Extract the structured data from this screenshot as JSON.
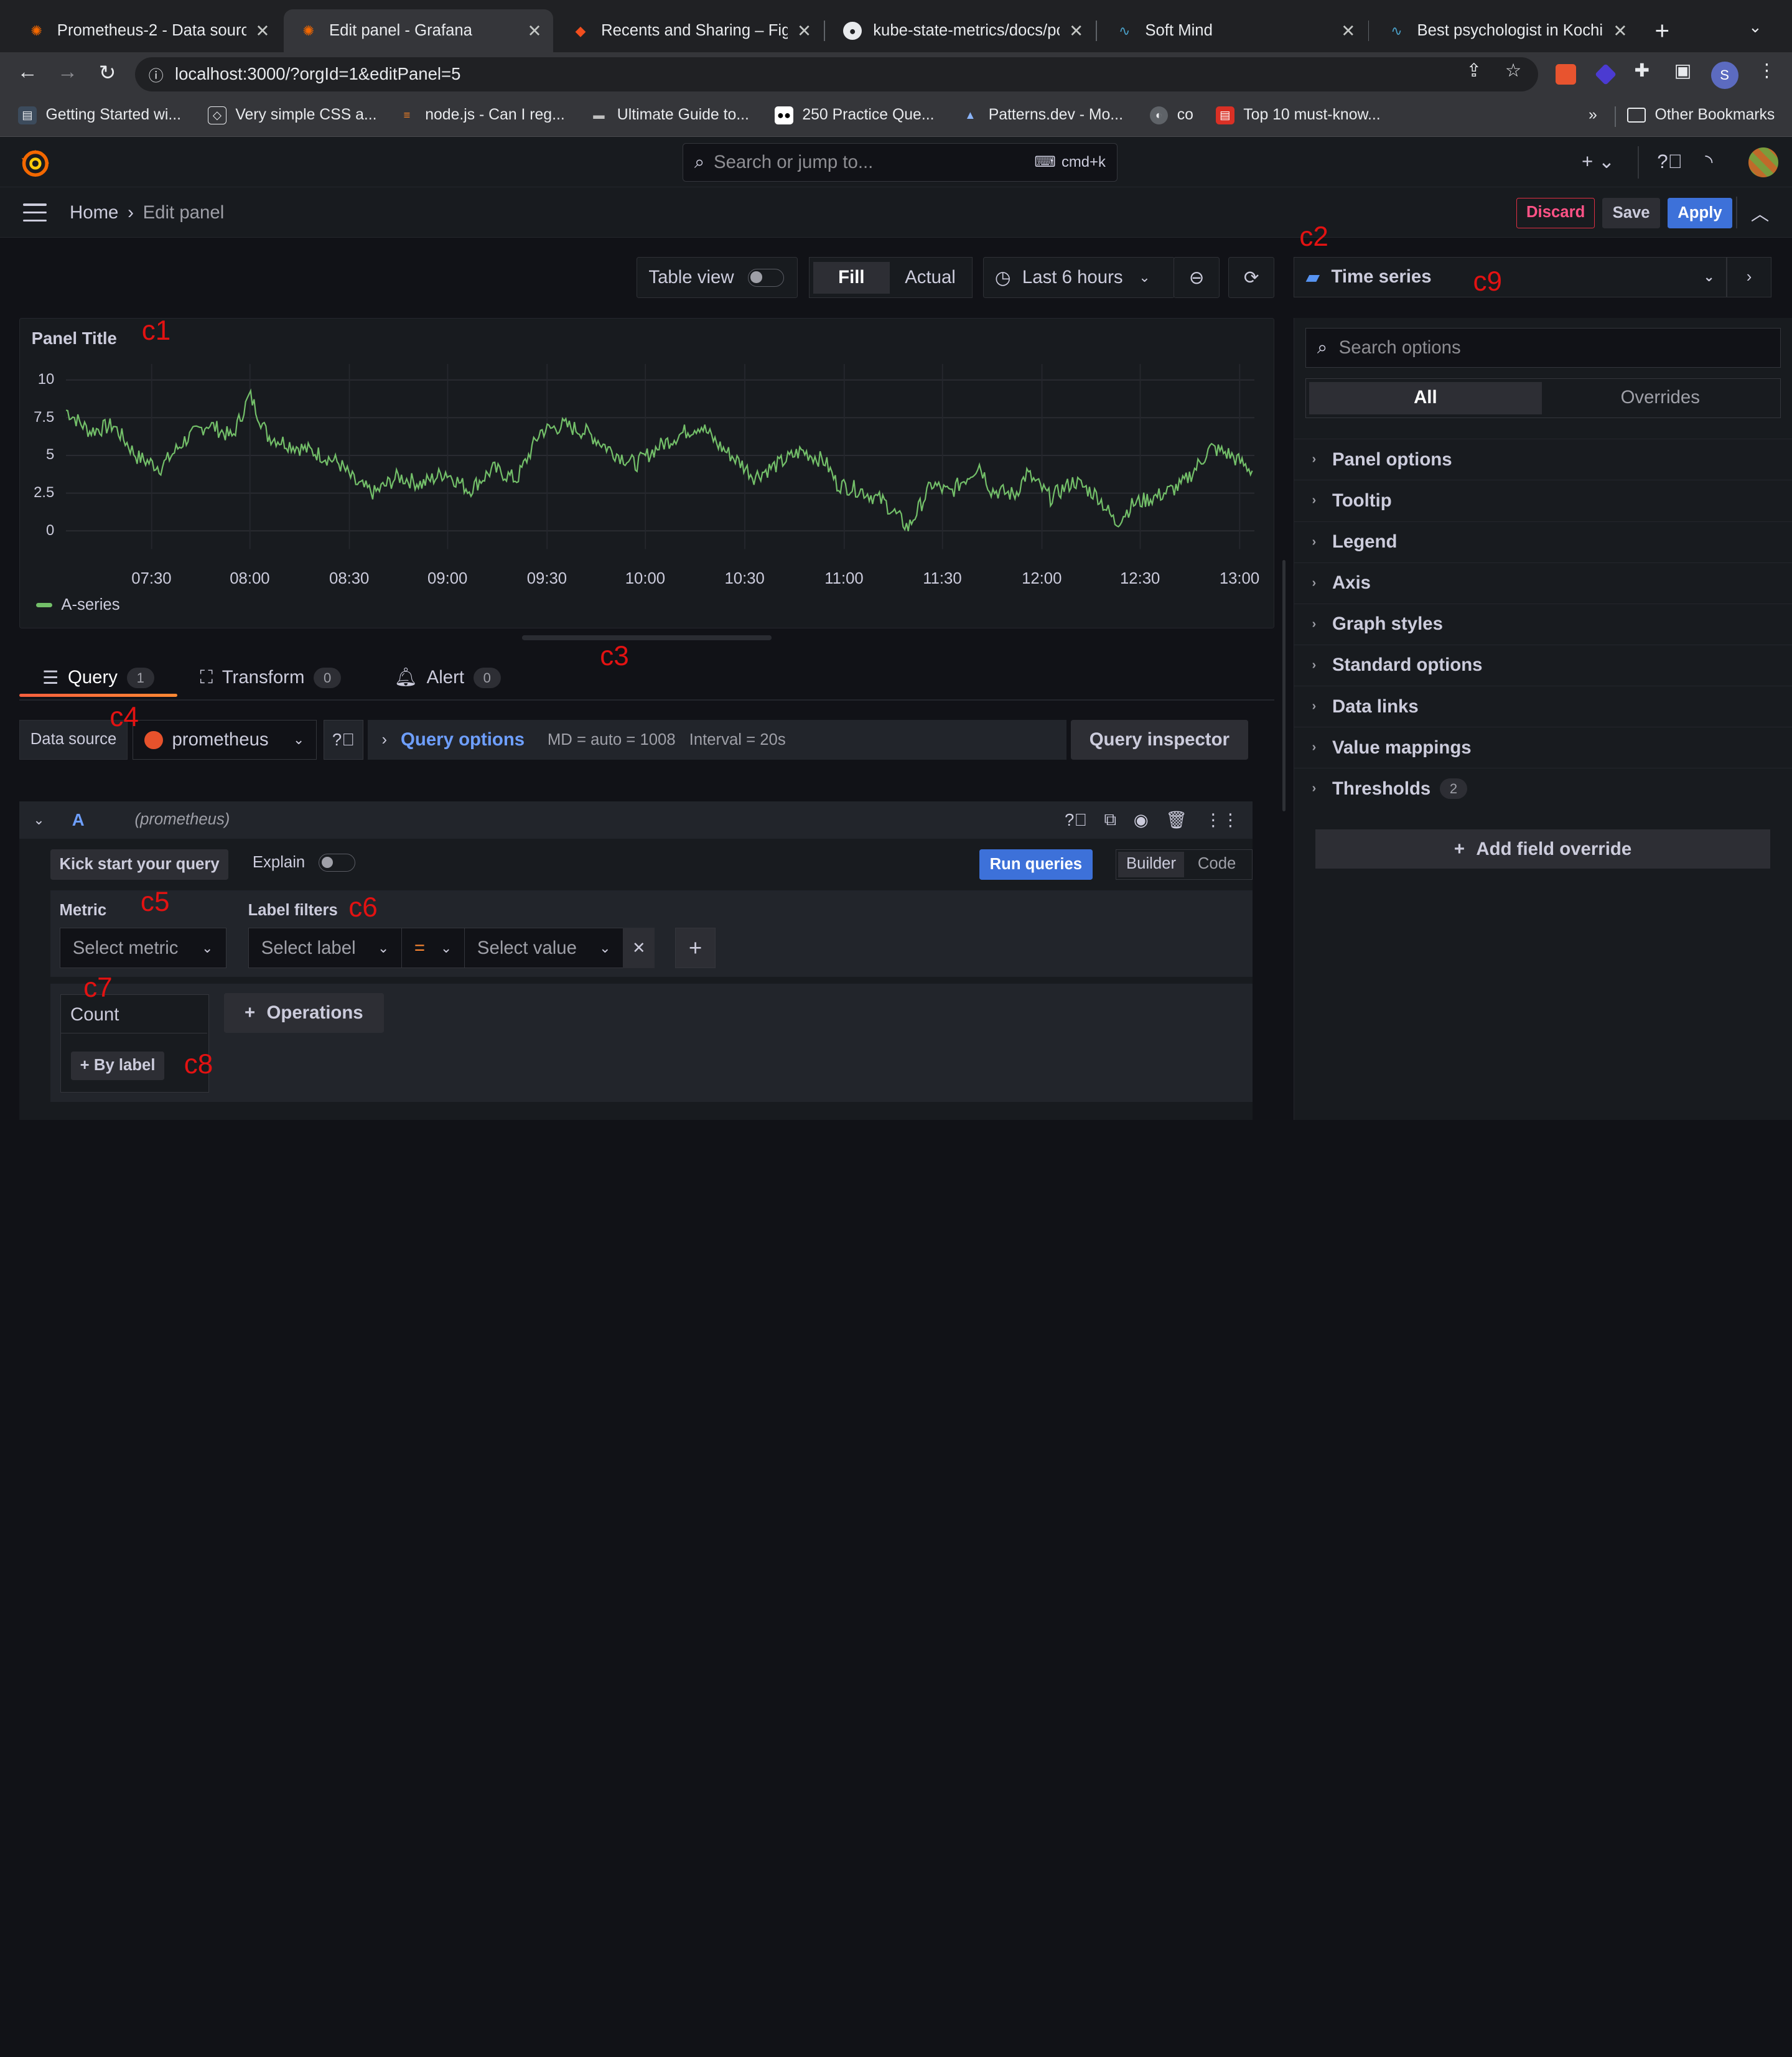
{
  "browser": {
    "tabs": [
      {
        "title": "Prometheus-2 - Data sources",
        "active": false
      },
      {
        "title": "Edit panel - Grafana",
        "active": true
      },
      {
        "title": "Recents and Sharing – Figma",
        "active": false
      },
      {
        "title": "kube-state-metrics/docs/pod",
        "active": false
      },
      {
        "title": "Soft Mind",
        "active": false
      },
      {
        "title": "Best psychologist in Kochi,",
        "active": false
      }
    ],
    "url": "localhost:3000/?orgId=1&editPanel=5",
    "profile_initial": "S",
    "bookmarks": [
      "Getting Started wi...",
      "Very simple CSS a...",
      "node.js - Can I reg...",
      "Ultimate Guide to...",
      "250 Practice Que...",
      "Patterns.dev - Mo...",
      "co",
      "Top 10 must-know..."
    ],
    "bookmarks_overflow": "»",
    "other_bookmarks": "Other Bookmarks"
  },
  "grafana": {
    "search_placeholder": "Search or jump to...",
    "search_shortcut": "cmd+k",
    "breadcrumb": {
      "home": "Home",
      "separator": "›",
      "current": "Edit panel"
    },
    "actions": {
      "discard": "Discard",
      "save": "Save",
      "apply": "Apply"
    },
    "panel_toolbar": {
      "table_view": "Table view",
      "fill": "Fill",
      "actual": "Actual",
      "time_range": "Last 6 hours"
    },
    "panel": {
      "title": "Panel Title",
      "legend": "A-series"
    },
    "query_tabs": [
      {
        "label": "Query",
        "count": "1"
      },
      {
        "label": "Transform",
        "count": "0"
      },
      {
        "label": "Alert",
        "count": "0"
      }
    ],
    "datasource": {
      "label": "Data source",
      "name": "prometheus",
      "query_options_label": "Query options",
      "md": "MD = auto = 1008",
      "interval": "Interval = 20s",
      "inspector": "Query inspector"
    },
    "query": {
      "ref": "A",
      "ds_hint": "(prometheus)",
      "kick_start": "Kick start your query",
      "explain": "Explain",
      "run": "Run queries",
      "builder": "Builder",
      "code": "Code",
      "metric_label": "Metric",
      "metric_placeholder": "Select metric",
      "label_filters": "Label filters",
      "select_label": "Select label",
      "operator": "=",
      "select_value": "Select value",
      "count": "Count",
      "by_label": "By label",
      "operations": "Operations"
    },
    "options": {
      "viz": "Time series",
      "search_placeholder": "Search options",
      "all": "All",
      "overrides": "Overrides",
      "sections": [
        "Panel options",
        "Tooltip",
        "Legend",
        "Axis",
        "Graph styles",
        "Standard options",
        "Data links",
        "Value mappings",
        "Thresholds"
      ],
      "thresholds_count": "2",
      "add_override": "Add field override"
    },
    "annotations": [
      "c1",
      "c2",
      "c3",
      "c4",
      "c5",
      "c6",
      "c7",
      "c8",
      "c9"
    ]
  },
  "chart_data": {
    "type": "line",
    "title": "Panel Title",
    "series": [
      {
        "name": "A-series",
        "color": "#73bf69"
      }
    ],
    "x_ticks": [
      "07:30",
      "08:00",
      "08:30",
      "09:00",
      "09:30",
      "10:00",
      "10:30",
      "11:00",
      "11:30",
      "12:00",
      "12:30",
      "13:00"
    ],
    "y_ticks": [
      "10",
      "7.5",
      "5",
      "2.5",
      "0"
    ],
    "ylim": [
      0,
      10
    ],
    "grid": true,
    "legend_position": "bottom-left",
    "points": [
      [
        0.0,
        8.0
      ],
      [
        0.02,
        6.6
      ],
      [
        0.04,
        7.0
      ],
      [
        0.06,
        4.9
      ],
      [
        0.08,
        4.2
      ],
      [
        0.1,
        6.0
      ],
      [
        0.12,
        7.1
      ],
      [
        0.14,
        6.2
      ],
      [
        0.155,
        9.0
      ],
      [
        0.17,
        6.3
      ],
      [
        0.19,
        5.7
      ],
      [
        0.21,
        5.2
      ],
      [
        0.23,
        4.5
      ],
      [
        0.245,
        3.1
      ],
      [
        0.26,
        2.5
      ],
      [
        0.28,
        3.6
      ],
      [
        0.3,
        3.1
      ],
      [
        0.32,
        3.9
      ],
      [
        0.34,
        2.7
      ],
      [
        0.36,
        4.1
      ],
      [
        0.38,
        3.4
      ],
      [
        0.4,
        6.6
      ],
      [
        0.42,
        7.0
      ],
      [
        0.44,
        6.5
      ],
      [
        0.46,
        5.3
      ],
      [
        0.48,
        4.4
      ],
      [
        0.5,
        5.6
      ],
      [
        0.52,
        6.5
      ],
      [
        0.535,
        7.0
      ],
      [
        0.55,
        5.7
      ],
      [
        0.57,
        4.4
      ],
      [
        0.58,
        3.6
      ],
      [
        0.6,
        4.4
      ],
      [
        0.62,
        5.3
      ],
      [
        0.64,
        4.6
      ],
      [
        0.65,
        3.1
      ],
      [
        0.67,
        2.7
      ],
      [
        0.69,
        1.9
      ],
      [
        0.71,
        0.2
      ],
      [
        0.73,
        3.1
      ],
      [
        0.745,
        2.5
      ],
      [
        0.76,
        3.6
      ],
      [
        0.77,
        4.4
      ],
      [
        0.78,
        2.7
      ],
      [
        0.8,
        2.4
      ],
      [
        0.81,
        3.8
      ],
      [
        0.83,
        2.2
      ],
      [
        0.85,
        3.3
      ],
      [
        0.87,
        2.3
      ],
      [
        0.885,
        0.5
      ],
      [
        0.9,
        1.8
      ],
      [
        0.92,
        2.3
      ],
      [
        0.94,
        3.0
      ],
      [
        0.95,
        3.9
      ],
      [
        0.965,
        5.5
      ],
      [
        0.98,
        5.1
      ],
      [
        1.0,
        4.0
      ]
    ]
  }
}
